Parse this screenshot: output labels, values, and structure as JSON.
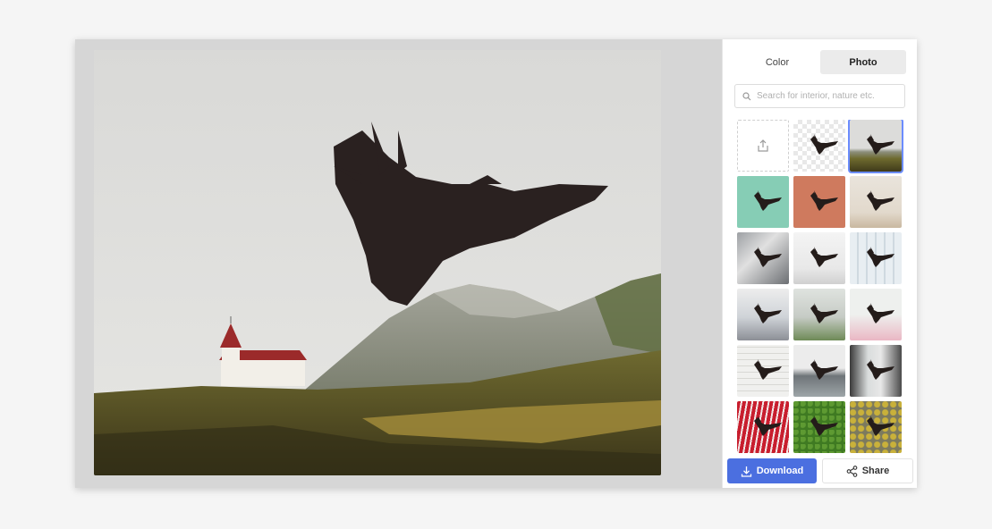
{
  "tabs": [
    {
      "label": "Color",
      "active": false
    },
    {
      "label": "Photo",
      "active": true
    }
  ],
  "search": {
    "placeholder": "Search for interior, nature etc.",
    "value": ""
  },
  "thumbnails": [
    {
      "kind": "upload",
      "icon": "upload-icon"
    },
    {
      "kind": "transparent"
    },
    {
      "kind": "landscape",
      "selected": true
    },
    {
      "kind": "mint"
    },
    {
      "kind": "terracotta"
    },
    {
      "kind": "room-beige"
    },
    {
      "kind": "office"
    },
    {
      "kind": "white-room"
    },
    {
      "kind": "glass"
    },
    {
      "kind": "warehouse"
    },
    {
      "kind": "building"
    },
    {
      "kind": "pink-room"
    },
    {
      "kind": "blinds"
    },
    {
      "kind": "harbor"
    },
    {
      "kind": "corridor"
    },
    {
      "kind": "red-paint"
    },
    {
      "kind": "hedge"
    },
    {
      "kind": "lichen"
    }
  ],
  "actions": {
    "download_label": "Download",
    "share_label": "Share"
  },
  "colors": {
    "accent": "#4b6fe0",
    "selection": "#6b8cff"
  }
}
